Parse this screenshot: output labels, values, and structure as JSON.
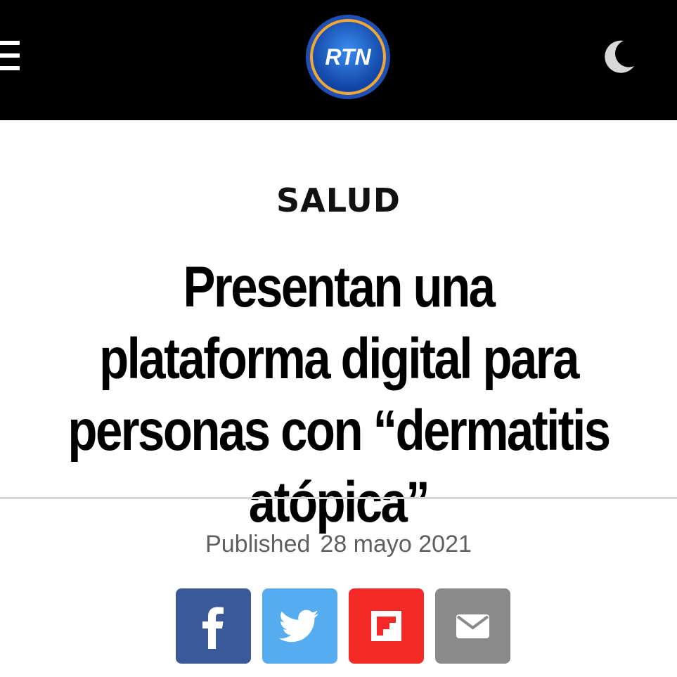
{
  "header": {
    "logo_text": "RTN",
    "colors": {
      "background": "#000000",
      "logo_ring": "#f0a830",
      "logo_blue": "#1a5fd0"
    }
  },
  "article": {
    "category": "SALUD",
    "title": "Presentan una plataforma digital para personas con “dermatitis atópica”",
    "published_label": "Published",
    "published_date": "28 mayo 2021"
  },
  "share": {
    "buttons": [
      {
        "name": "facebook",
        "icon": "facebook-icon",
        "color": "#3b5998"
      },
      {
        "name": "twitter",
        "icon": "twitter-icon",
        "color": "#55acee"
      },
      {
        "name": "flipboard",
        "icon": "flipboard-icon",
        "color": "#f52828"
      },
      {
        "name": "email",
        "icon": "envelope-icon",
        "color": "#8a8a8a"
      }
    ]
  }
}
